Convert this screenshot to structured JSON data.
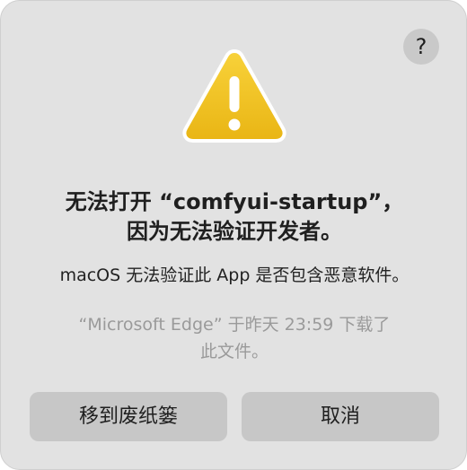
{
  "dialog": {
    "help_label": "?",
    "title_line1": "无法打开 “comfyui-startup”，",
    "title_line2": "因为无法验证开发者。",
    "message": "macOS 无法验证此 App 是否包含恶意软件。",
    "download_line1": "“Microsoft Edge” 于昨天 23:59 下载了",
    "download_line2": "此文件。",
    "buttons": {
      "move_to_trash": "移到废纸篓",
      "cancel": "取消"
    },
    "icons": {
      "warning": "warning-triangle-icon",
      "help": "question-mark-icon"
    },
    "colors": {
      "dialog_bg": "#e2e2e2",
      "button_bg": "#c7c7c7",
      "warning_yellow": "#f5c72a",
      "warning_mark": "#ffffff"
    }
  }
}
